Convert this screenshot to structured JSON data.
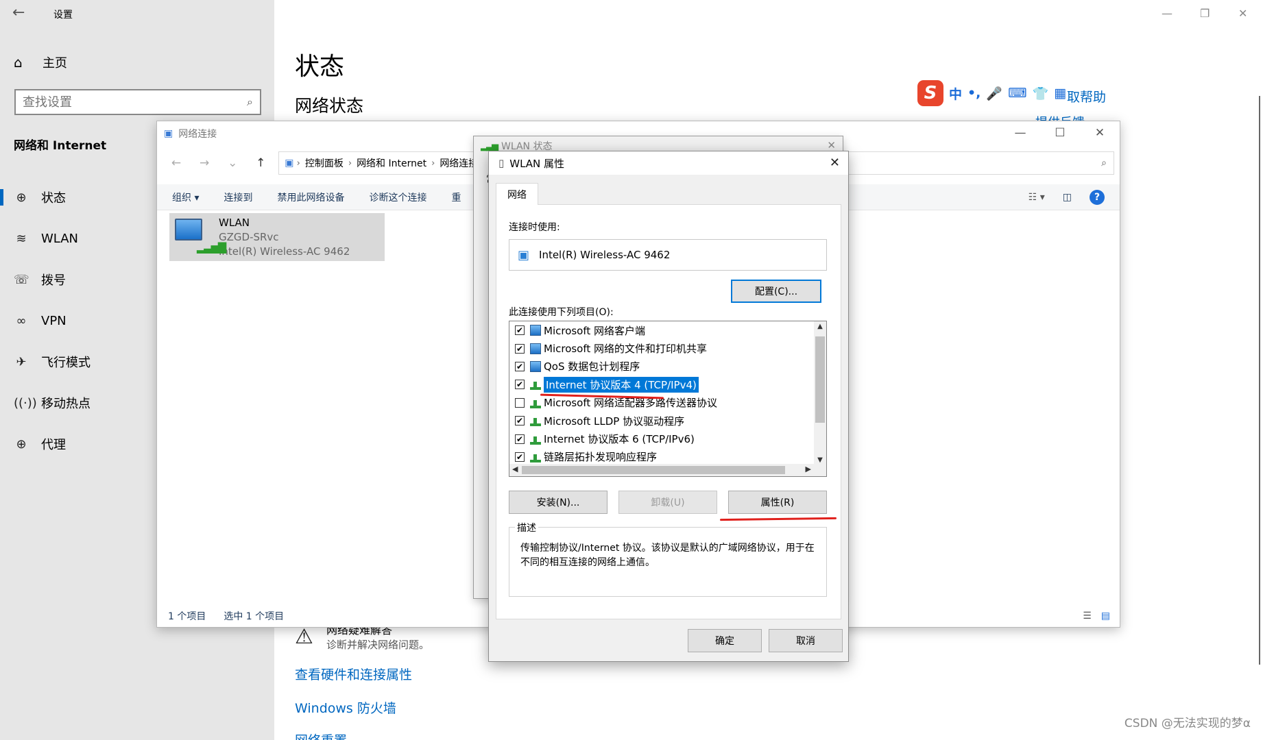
{
  "settings": {
    "app_title": "设置",
    "home_label": "主页",
    "search_placeholder": "查找设置",
    "category": "网络和 Internet",
    "nav": [
      {
        "label": "状态"
      },
      {
        "label": "WLAN"
      },
      {
        "label": "拨号"
      },
      {
        "label": "VPN"
      },
      {
        "label": "飞行模式"
      },
      {
        "label": "移动热点"
      },
      {
        "label": "代理"
      }
    ],
    "page_title": "状态",
    "section_title": "网络状态",
    "help_link": "取帮助",
    "feedback_link": "提供反馈",
    "troubleshoot_title": "网络疑难解答",
    "troubleshoot_desc": "诊断并解决网络问题。",
    "links": [
      "查看硬件和连接属性",
      "Windows 防火墙",
      "网络重置"
    ],
    "ime_items": [
      "中",
      "•,",
      "🎤",
      "⌨",
      "👕",
      "▦"
    ]
  },
  "netconn": {
    "title": "网络连接",
    "path": [
      "控制面板",
      "网络和 Internet",
      "网络连接"
    ],
    "toolbar": [
      "组织 ▾",
      "连接到",
      "禁用此网络设备",
      "诊断这个连接",
      "重"
    ],
    "item": {
      "name": "WLAN",
      "ssid": "GZGD-SRvc",
      "adapter": "Intel(R) Wireless-AC 9462"
    },
    "status_count": "1 个项目",
    "status_selected": "选中 1 个项目"
  },
  "wlan_status": {
    "title": "WLAN 状态",
    "tab_hint": "常"
  },
  "wlan_props": {
    "title": "WLAN 属性",
    "tab": "网络",
    "connect_using_label": "连接时使用:",
    "adapter": "Intel(R) Wireless-AC 9462",
    "configure_button": "配置(C)...",
    "items_label": "此连接使用下列项目(O):",
    "items": [
      {
        "label": "Microsoft 网络客户端",
        "checked": true,
        "icon": "client"
      },
      {
        "label": "Microsoft 网络的文件和打印机共享",
        "checked": true,
        "icon": "client"
      },
      {
        "label": "QoS 数据包计划程序",
        "checked": true,
        "icon": "client"
      },
      {
        "label": "Internet 协议版本 4 (TCP/IPv4)",
        "checked": true,
        "icon": "proto",
        "selected": true
      },
      {
        "label": "Microsoft 网络适配器多路传送器协议",
        "checked": false,
        "icon": "proto"
      },
      {
        "label": "Microsoft LLDP 协议驱动程序",
        "checked": true,
        "icon": "proto"
      },
      {
        "label": "Internet 协议版本 6 (TCP/IPv6)",
        "checked": true,
        "icon": "proto"
      },
      {
        "label": "链路层拓扑发现响应程序",
        "checked": true,
        "icon": "proto"
      }
    ],
    "install_button": "安装(N)...",
    "uninstall_button": "卸载(U)",
    "properties_button": "属性(R)",
    "desc_label": "描述",
    "desc_text": "传输控制协议/Internet 协议。该协议是默认的广域网络协议，用于在不同的相互连接的网络上通信。",
    "ok_button": "确定",
    "cancel_button": "取消"
  },
  "watermark": "CSDN @无法实现的梦α",
  "colors": {
    "accent": "#0078d7",
    "link": "#0067c0",
    "annotation": "#e0201c"
  }
}
